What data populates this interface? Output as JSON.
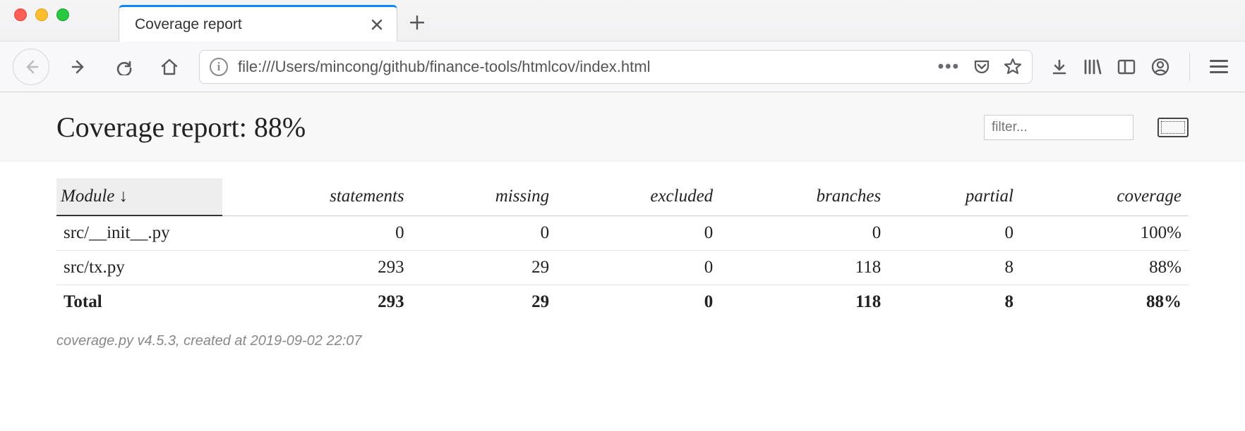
{
  "browser": {
    "tab_title": "Coverage report",
    "url": "file:///Users/mincong/github/finance-tools/htmlcov/index.html"
  },
  "report": {
    "title_prefix": "Coverage report:",
    "title_percent": "88%",
    "filter_placeholder": "filter...",
    "columns": {
      "module": "Module ↓",
      "statements": "statements",
      "missing": "missing",
      "excluded": "excluded",
      "branches": "branches",
      "partial": "partial",
      "coverage": "coverage"
    },
    "rows": [
      {
        "module": "src/__init__.py",
        "statements": "0",
        "missing": "0",
        "excluded": "0",
        "branches": "0",
        "partial": "0",
        "coverage": "100%"
      },
      {
        "module": "src/tx.py",
        "statements": "293",
        "missing": "29",
        "excluded": "0",
        "branches": "118",
        "partial": "8",
        "coverage": "88%"
      }
    ],
    "total": {
      "label": "Total",
      "statements": "293",
      "missing": "29",
      "excluded": "0",
      "branches": "118",
      "partial": "8",
      "coverage": "88%"
    },
    "footer": "coverage.py v4.5.3, created at 2019-09-02 22:07"
  }
}
